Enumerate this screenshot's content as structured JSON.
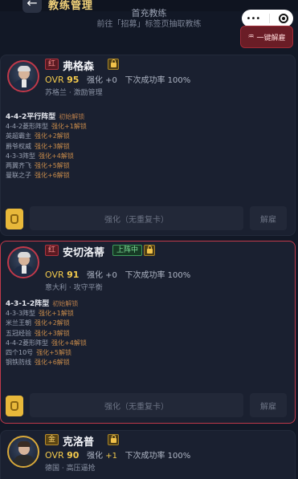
{
  "header": {
    "title": "教练管理",
    "back_icon": "arrow-left-icon",
    "capsule_more": "•••"
  },
  "empty_hint": {
    "line1": "首充教练",
    "line2": "前往「招募」标签页抽取教练"
  },
  "dismiss_all_label": "一键解雇",
  "coaches": [
    {
      "rank": "红",
      "name": "弗格森",
      "on_field": "",
      "ovr_label": "OVR",
      "ovr": "95",
      "enhance_text": "强化 +0",
      "success_text": "下次成功率 100%",
      "nation": "苏格兰",
      "style": "激励管理",
      "tactics": [
        {
          "name": "4-4-2平行阵型",
          "status": "初始解锁"
        },
        {
          "name": "4-4-2菱形阵型",
          "status": "强化+1解锁"
        },
        {
          "name": "英超霸主",
          "status": "强化+2解锁"
        },
        {
          "name": "爵爷权威",
          "status": "强化+3解锁"
        },
        {
          "name": "4-3-3阵型",
          "status": "强化+4解锁"
        },
        {
          "name": "两翼齐飞",
          "status": "强化+5解锁"
        },
        {
          "name": "曼联之子",
          "status": "强化+6解锁"
        }
      ],
      "enhance_btn": "强化（无重复卡）",
      "dismiss_btn": "解雇"
    },
    {
      "rank": "红",
      "name": "安切洛蒂",
      "on_field": "上阵中",
      "ovr_label": "OVR",
      "ovr": "91",
      "enhance_text": "强化 +0",
      "success_text": "下次成功率 100%",
      "nation": "意大利",
      "style": "攻守平衡",
      "tactics": [
        {
          "name": "4-3-1-2阵型",
          "status": "初始解锁"
        },
        {
          "name": "4-3-3阵型",
          "status": "强化+1解锁"
        },
        {
          "name": "米兰王朝",
          "status": "强化+2解锁"
        },
        {
          "name": "五冠经验",
          "status": "强化+3解锁"
        },
        {
          "name": "4-4-2菱形阵型",
          "status": "强化+4解锁"
        },
        {
          "name": "四个10号",
          "status": "强化+5解锁"
        },
        {
          "name": "钢铁防线",
          "status": "强化+6解锁"
        }
      ],
      "enhance_btn": "强化（无重复卡）",
      "dismiss_btn": "解雇"
    },
    {
      "rank": "金",
      "name": "克洛普",
      "on_field": "",
      "ovr_label": "OVR",
      "ovr": "90",
      "enhance_prefix": "强化",
      "enhance_value": "+1",
      "success_text": "下次成功率 100%",
      "nation": "德国",
      "style": "高压逼抢"
    }
  ]
}
